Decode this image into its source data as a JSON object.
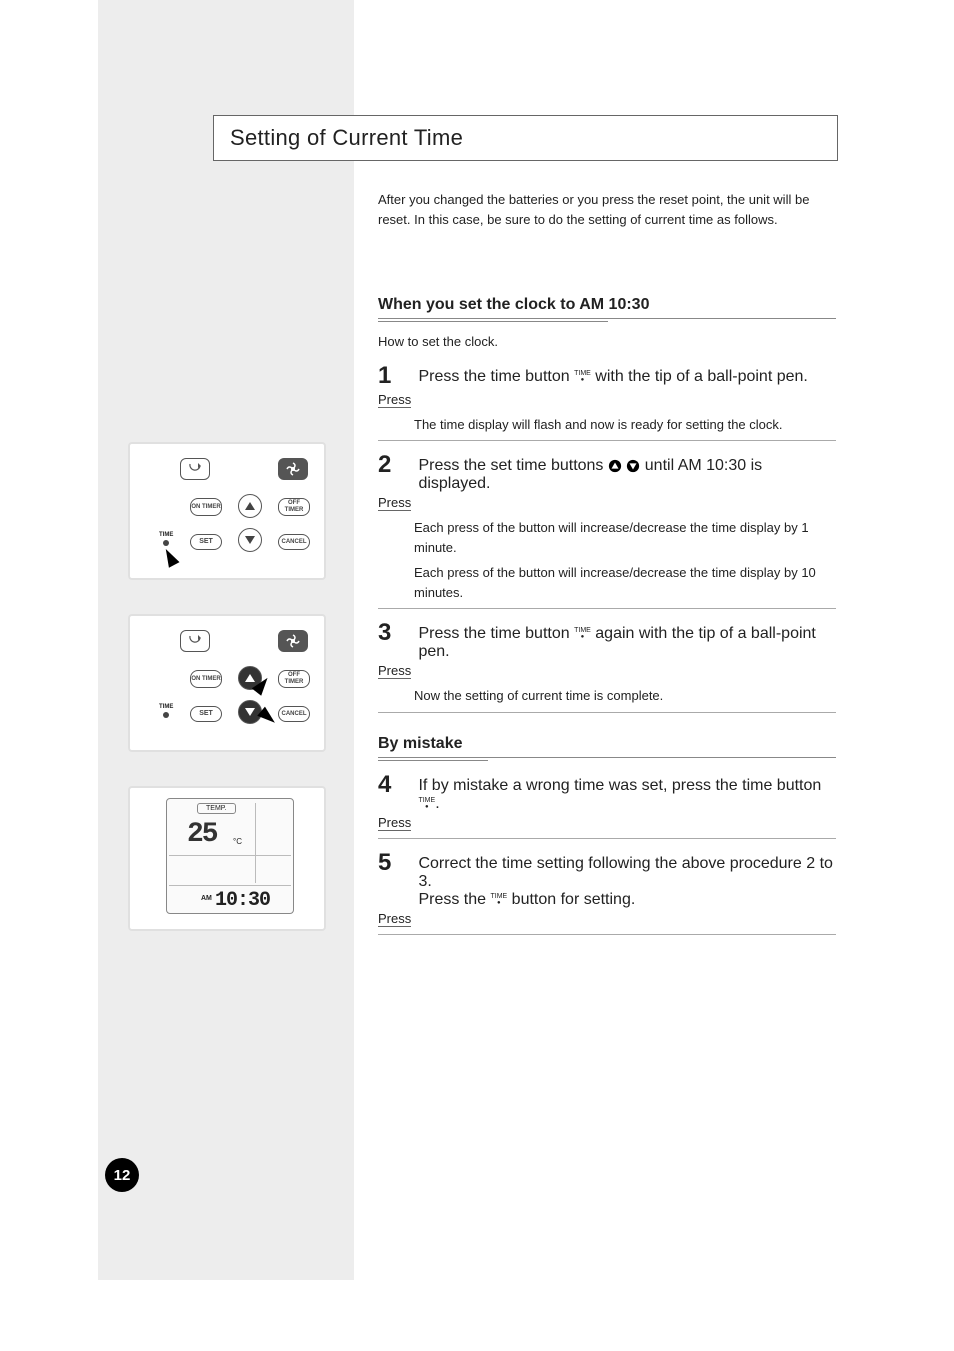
{
  "title": "Setting of Current Time",
  "intro": "After you changed the batteries or you press the reset point, the unit will be reset. In this case, be sure to do the setting of current time as follows.",
  "step1": {
    "heading": "When you set the clock to AM 10:30",
    "body": "How to set the clock.",
    "s1": {
      "num": "1",
      "label": "Press",
      "text": "Press the time button with the tip of a ball-point pen. The time display will flash and now is ready for setting the clock."
    },
    "s2": {
      "num": "2",
      "label": "Press",
      "text": "Press the set time buttons until AM 10:30 is displayed.",
      "foot": "Each press of the button will increase/decrease the time display by 1 minute.",
      "foot2": "Each press of the button will increase/decrease the time display by 10 minutes."
    },
    "s3": {
      "num": "3",
      "label": "Press",
      "text": "Press the time button again with the tip of a ball-point pen. Now the setting of current time is complete."
    }
  },
  "step2": {
    "heading": "By mistake",
    "s4": {
      "num": "4",
      "label": "Press",
      "text": "If by mistake a wrong time was set, press the time button."
    },
    "s5": {
      "num": "5",
      "label": "Press",
      "text": "Correct the time setting following the above procedure 2 to 3.\nPress the button for setting."
    }
  },
  "lcd": {
    "temp_label": "TEMP.",
    "temp_value": "25",
    "temp_unit": "°C",
    "am": "AM",
    "clock": "10:30"
  },
  "remote": {
    "on_timer": "ON\nTIMER",
    "off_timer": "OFF\nTIMER",
    "set": "SET",
    "cancel": "CANCEL",
    "time_label": "TIME"
  },
  "page_number": "12",
  "icons": {
    "time": "TIME",
    "up": "▲",
    "down": "▼"
  }
}
